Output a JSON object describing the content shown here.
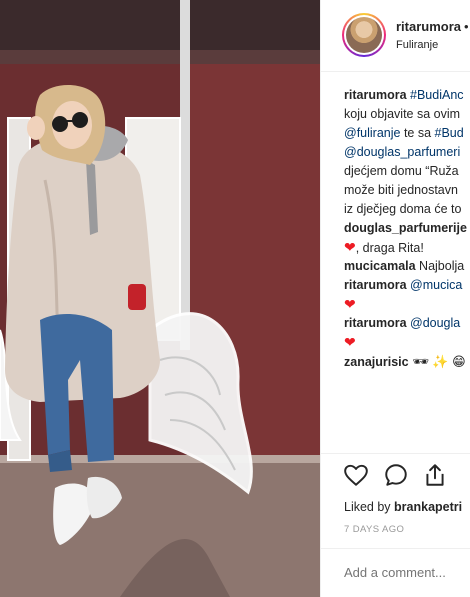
{
  "post": {
    "username": "ritarumora",
    "dot": "•",
    "location": "Fuliranje"
  },
  "comments": {
    "caption": [
      {
        "parts": [
          {
            "t": "ritarumora",
            "s": "b"
          },
          {
            "t": " "
          },
          {
            "t": "#BudiAnc",
            "s": "link"
          }
        ]
      },
      {
        "parts": [
          {
            "t": "koju objavite sa ovim"
          }
        ]
      },
      {
        "parts": [
          {
            "t": "@fuliranje",
            "s": "link"
          },
          {
            "t": " te sa "
          },
          {
            "t": "#Bud",
            "s": "link"
          }
        ]
      },
      {
        "parts": [
          {
            "t": "@douglas_parfumeri",
            "s": "link"
          }
        ]
      },
      {
        "parts": [
          {
            "t": "djećjem domu “Ruža"
          }
        ]
      },
      {
        "parts": [
          {
            "t": "može biti jednostavn"
          }
        ]
      },
      {
        "parts": [
          {
            "t": "iz dječjeg doma će to"
          }
        ]
      }
    ],
    "replies": [
      {
        "lines": [
          {
            "parts": [
              {
                "t": "douglas_parfumerije",
                "s": "b"
              }
            ]
          },
          {
            "parts": [
              {
                "t": "❤",
                "s": "heart"
              },
              {
                "t": ", draga Rita!"
              }
            ]
          }
        ]
      },
      {
        "lines": [
          {
            "parts": [
              {
                "t": "mucicamala",
                "s": "b"
              },
              {
                "t": " Najbolja"
              }
            ]
          }
        ]
      },
      {
        "lines": [
          {
            "parts": [
              {
                "t": "ritarumora",
                "s": "b"
              },
              {
                "t": " "
              },
              {
                "t": "@mucica",
                "s": "link"
              }
            ]
          },
          {
            "parts": [
              {
                "t": "❤",
                "s": "heart"
              }
            ]
          }
        ]
      },
      {
        "lines": [
          {
            "parts": [
              {
                "t": "ritarumora",
                "s": "b"
              },
              {
                "t": " "
              },
              {
                "t": "@dougla",
                "s": "link"
              }
            ]
          },
          {
            "parts": [
              {
                "t": "❤",
                "s": "heart"
              }
            ]
          }
        ]
      },
      {
        "lines": [
          {
            "parts": [
              {
                "t": "zanajurisic",
                "s": "b"
              },
              {
                "t": " 🕶 ✨ 😁",
                "s": "emoji"
              }
            ]
          }
        ]
      }
    ]
  },
  "actions": {
    "like_icon": "heart-outline-icon",
    "comment_icon": "comment-bubble-icon",
    "share_icon": "share-icon"
  },
  "likes": {
    "prefix": "Liked by ",
    "user": "brankapetri"
  },
  "timestamp": "7 DAYS AGO",
  "add_comment_placeholder": "Add a comment...",
  "colors": {
    "link": "#003569",
    "heart": "#ed1c24",
    "muted": "#999999",
    "text": "#262626"
  }
}
